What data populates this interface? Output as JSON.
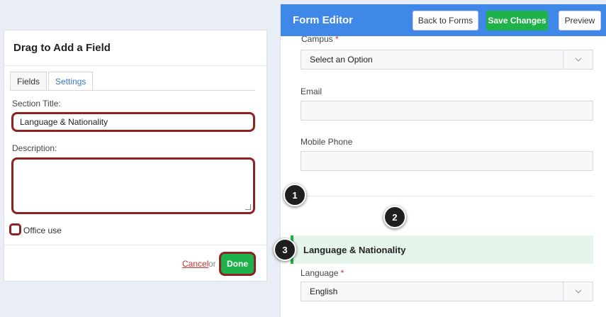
{
  "left_panel": {
    "title": "Drag to Add a Field",
    "tabs": [
      "Fields",
      "Settings"
    ],
    "active_tab": "Settings",
    "section_title_label": "Section Title:",
    "section_title_value": "Language & Nationality",
    "description_label": "Description:",
    "description_value": "",
    "office_use_label": "Office use",
    "cancel_label": "Cancel",
    "or_text": "or",
    "done_label": "Done"
  },
  "editor": {
    "title": "Form Editor",
    "back_label": "Back to Forms",
    "save_label": "Save Changes",
    "preview_label": "Preview",
    "required_mark": "*",
    "fields": {
      "campus_label": "Campus",
      "campus_value": "Select an Option",
      "email_label": "Email",
      "mobile_label": "Mobile Phone",
      "section_title": "Language & Nationality",
      "language_label": "Language",
      "language_value": "English"
    }
  },
  "steps": [
    "1",
    "2",
    "3"
  ],
  "colors": {
    "topbar": "#3f88e8",
    "save_green": "#1fb24a",
    "highlight_red": "#8c2323",
    "section_band": "#e6f5ec",
    "cancel_red": "#c9302c"
  },
  "icons": {
    "select_caret": "chevron-down-icon"
  }
}
